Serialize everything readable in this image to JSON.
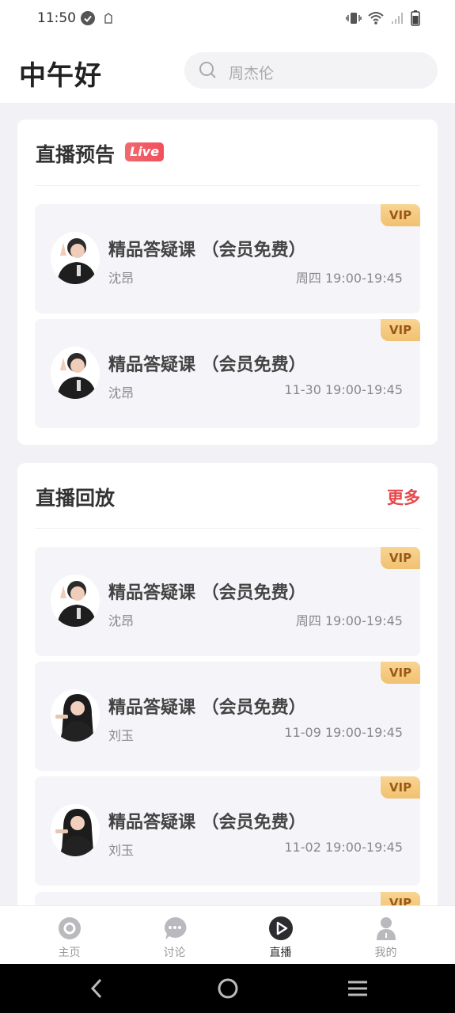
{
  "status": {
    "time": "11:50"
  },
  "header": {
    "greeting": "中午好",
    "search_placeholder": "周杰伦"
  },
  "preview": {
    "title": "直播预告",
    "badge": "Live",
    "cards": [
      {
        "title": "精品答疑课 （会员免费）",
        "teacher": "沈昂",
        "time": "周四 19:00-19:45",
        "tag": "VIP"
      },
      {
        "title": "精品答疑课 （会员免费）",
        "teacher": "沈昂",
        "time": "11-30 19:00-19:45",
        "tag": "VIP"
      }
    ]
  },
  "replay": {
    "title": "直播回放",
    "more": "更多",
    "cards": [
      {
        "title": "精品答疑课 （会员免费）",
        "teacher": "沈昂",
        "time": "周四 19:00-19:45",
        "tag": "VIP"
      },
      {
        "title": "精品答疑课 （会员免费）",
        "teacher": "刘玉",
        "time": "11-09 19:00-19:45",
        "tag": "VIP"
      },
      {
        "title": "精品答疑课 （会员免费）",
        "teacher": "刘玉",
        "time": "11-02 19:00-19:45",
        "tag": "VIP"
      },
      {
        "tag": "VIP"
      }
    ]
  },
  "tabs": [
    {
      "label": "主页",
      "icon": "home-icon"
    },
    {
      "label": "讨论",
      "icon": "chat-icon"
    },
    {
      "label": "直播",
      "icon": "live-play-icon",
      "active": true
    },
    {
      "label": "我的",
      "icon": "profile-icon"
    }
  ],
  "colors": {
    "accent": "#e5484d",
    "vip_text": "#9a5a16",
    "card_bg": "#f5f5f9"
  }
}
